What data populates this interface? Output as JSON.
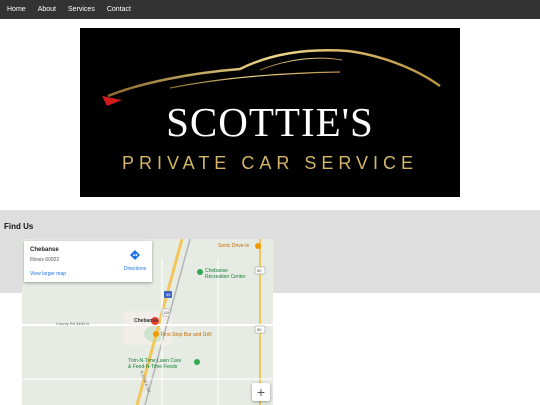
{
  "nav": {
    "items": [
      {
        "label": "Home"
      },
      {
        "label": "About"
      },
      {
        "label": "Services"
      },
      {
        "label": "Contact"
      }
    ]
  },
  "logo": {
    "title": "SCOTTIE'S",
    "subtitle": "PRIVATE CAR SERVICE"
  },
  "find_us": {
    "title": "Find Us"
  },
  "map": {
    "card": {
      "place_name": "Chebanse",
      "address": "Illinois 60922",
      "larger_map_label": "View larger map",
      "directions_label": "Directions"
    },
    "labels": {
      "sonic": "Sonic Drive-In",
      "recreation_line1": "Chebanse",
      "recreation_line2": "Recreation Center",
      "town": "Chebanse",
      "first_stop": "First Stop Bar and Grill",
      "road": "County Rd 3400 N",
      "trim_line1": "Trim-N-Time Lawn Care",
      "trim_line2": "& Feed-N-Time Feeds",
      "shield_route": "45",
      "shield_top": "50",
      "shield_mid": "50",
      "shield_small": "115",
      "road_side": "N 1200 E Rd"
    },
    "zoom_in_label": "+"
  },
  "colors": {
    "nav_bg": "#333333",
    "logo_gold": "#d4b56a",
    "band_bg": "#dedede",
    "map_link": "#1a73e8"
  }
}
